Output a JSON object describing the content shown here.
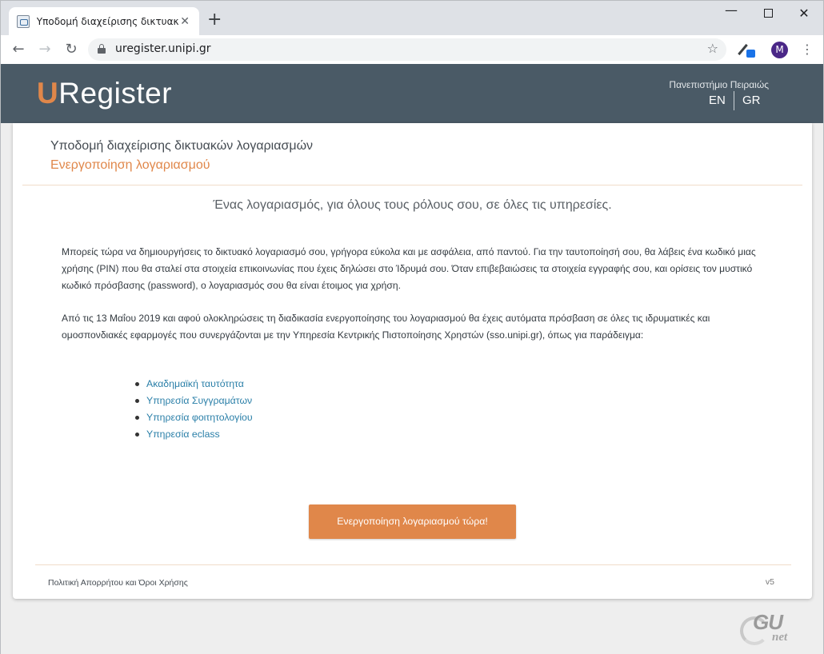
{
  "browser": {
    "tab_title": "Υποδομή διαχείρισης δικτυακών λογαριασμών",
    "tab_close": "✕",
    "new_tab": "+",
    "url": "uregister.unipi.gr",
    "star": "☆",
    "profile_initial": "M",
    "menu": "⋮",
    "window_minimize": "—",
    "window_close": "✕",
    "back": "←",
    "forward": "→",
    "reload": "↻"
  },
  "header": {
    "logo_u": "U",
    "logo_rest": "Register",
    "university": "Πανεπιστήμιο Πειραιώς",
    "lang_en": "EN",
    "lang_gr": "GR"
  },
  "card": {
    "title": "Υποδομή διαχείρισης δικτυακών λογαριασμών",
    "subtitle": "Ενεργοποίηση λογαριασμού",
    "tagline": "Ένας λογαριασμός, για όλους τους ρόλους σου, σε όλες τις υπηρεσίες.",
    "paragraph1": "Μπορείς τώρα να δημιουργήσεις το δικτυακό λογαριασμό σου, γρήγορα εύκολα και με ασφάλεια, από παντού. Για την ταυτοποίησή σου, θα λάβεις ένα κωδικό μιας χρήσης (PIN) που θα σταλεί στα στοιχεία επικοινωνίας που έχεις δηλώσει στο Ίδρυμά σου. Όταν επιβεβαιώσεις τα στοιχεία εγγραφής σου, και ορίσεις τον μυστικό κωδικό πρόσβασης (password), ο λογαριασμός σου θα είναι έτοιμος για χρήση.",
    "paragraph2": "Από τις 13 Μαΐου 2019 και αφού ολοκληρώσεις τη διαδικασία ενεργοποίησης του λογαριασμού θα έχεις αυτόματα πρόσβαση σε όλες τις ιδρυματικές και ομοσπονδιακές εφαρμογές που συνεργάζονται με την Υπηρεσία Κεντρικής Πιστοποίησης Χρηστών (sso.unipi.gr), όπως για παράδειγμα:",
    "links": [
      "Ακαδημαϊκή ταυτότητα",
      "Υπηρεσία Συγγραμάτων",
      "Υπηρεσία φοιτητολογίου",
      "Υπηρεσία eclass"
    ],
    "cta_label": "Ενεργοποίηση λογαριασμού τώρα!",
    "footer_link": "Πολιτική Απορρήτου και Όροι Χρήσης",
    "version": "v5"
  },
  "watermark": {
    "text_main": "GU",
    "text_sub": "net"
  },
  "colors": {
    "header_bg": "#4a5a66",
    "accent": "#e0874a",
    "link": "#2a7fa8"
  }
}
